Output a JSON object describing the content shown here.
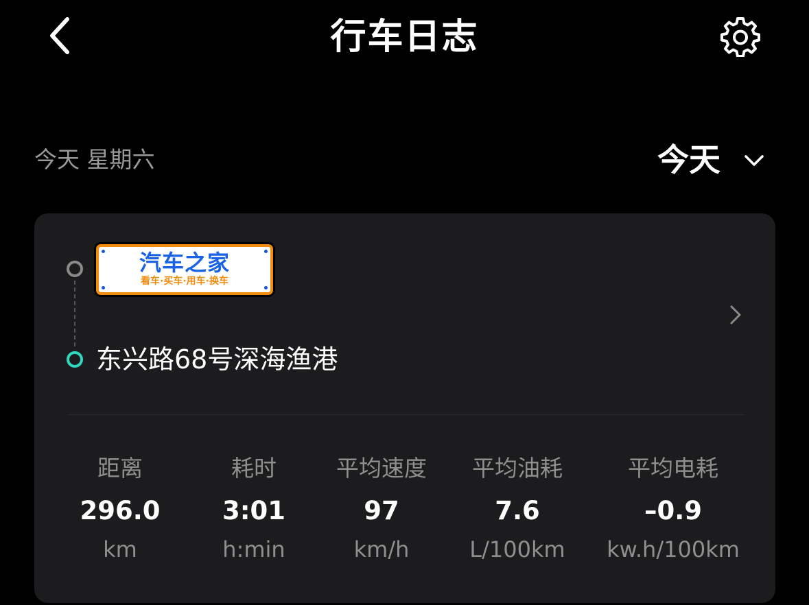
{
  "header": {
    "title": "行车日志",
    "back_icon": "chevron-left-icon",
    "settings_icon": "gear-icon"
  },
  "date": {
    "label": "今天 星期六",
    "selector_value": "今天",
    "selector_icon": "chevron-down-icon"
  },
  "trip": {
    "start_logo_main": "汽车之家",
    "start_logo_sub": "看车·买车·用车·换车",
    "destination": "东兴路68号深海渔港",
    "start_dot_color": "#8a8a8a",
    "end_dot_color": "#2fd9bf"
  },
  "stats": [
    {
      "label": "距离",
      "value": "296.0",
      "unit": "km"
    },
    {
      "label": "耗时",
      "value": "3:01",
      "unit": "h:min"
    },
    {
      "label": "平均速度",
      "value": "97",
      "unit": "km/h"
    },
    {
      "label": "平均油耗",
      "value": "7.6",
      "unit": "L/100km"
    },
    {
      "label": "平均电耗",
      "value": "–0.9",
      "unit": "kw.h/100km"
    }
  ]
}
